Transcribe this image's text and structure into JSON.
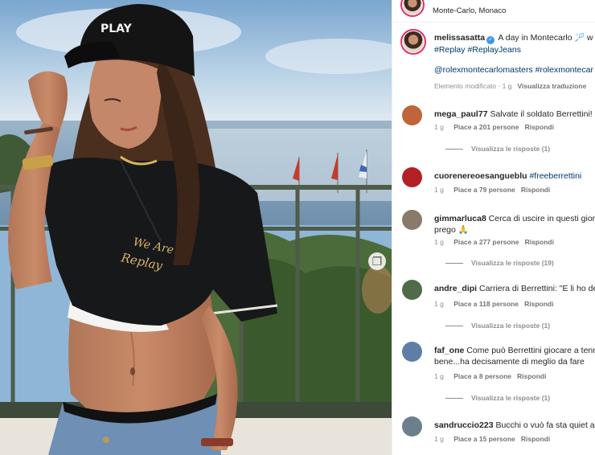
{
  "header": {
    "location": "Monte-Carlo, Monaco"
  },
  "caption": {
    "username": "melissasatta",
    "text": "A day in Montecarlo",
    "racket_icon": "tennis-racket-icon",
    "text_tail": "w",
    "hashtags_line1": "#Replay #ReplayJeans",
    "mentions_line": "@rolexmontecarlomasters #rolexmontecar",
    "meta_edited": "Elemento modificato · 1 g",
    "meta_translate": "Visualizza traduzione"
  },
  "shirt_embroidery": [
    "We Are",
    "Replay"
  ],
  "cap_logo": "PLAY",
  "comments": [
    {
      "username": "mega_paul77",
      "text": "Salvate il soldato Berrettini!",
      "time": "1 g",
      "likes": "Piace a 201 persone",
      "reply": "Rispondi",
      "replies": "Visualizza le risposte (1)",
      "avatar_color": "#c0643a"
    },
    {
      "username": "cuorenereoesangueblu",
      "text": "#freeberrettini",
      "text_is_tag": true,
      "time": "1 g",
      "likes": "Piace a 79 persone",
      "reply": "Rispondi",
      "replies": "",
      "avatar_color": "#b32025"
    },
    {
      "username": "gimmarluca8",
      "text": "Cerca di uscire in questi gior",
      "text2": "prego",
      "emoji": "🙏",
      "time": "1 g",
      "likes": "Piace a 277 persone",
      "reply": "Rispondi",
      "replies": "Visualizza le risposte (19)",
      "avatar_color": "#8a7a6a"
    },
    {
      "username": "andre_dipi",
      "text": "Carriera di Berrettini: \"E li ho de",
      "time": "1 g",
      "likes": "Piace a 118 persone",
      "reply": "Rispondi",
      "replies": "Visualizza le risposte (1)",
      "avatar_color": "#4f6b4a"
    },
    {
      "username": "faf_one",
      "text": "Come può Berrettini giocare a tenn",
      "text2": "bene...ha decisamente di meglio da fare",
      "time": "1 g",
      "likes": "Piace a 8 persone",
      "reply": "Rispondi",
      "replies": "Visualizza le risposte (1)",
      "avatar_color": "#5f7ea6"
    },
    {
      "username": "sandruccio223",
      "text": "Bucchi o vuò fa sta quiet a",
      "time": "1 g",
      "likes": "Piace a 15 persone",
      "reply": "Rispondi",
      "replies": "",
      "avatar_color": "#6b7f8c"
    }
  ]
}
